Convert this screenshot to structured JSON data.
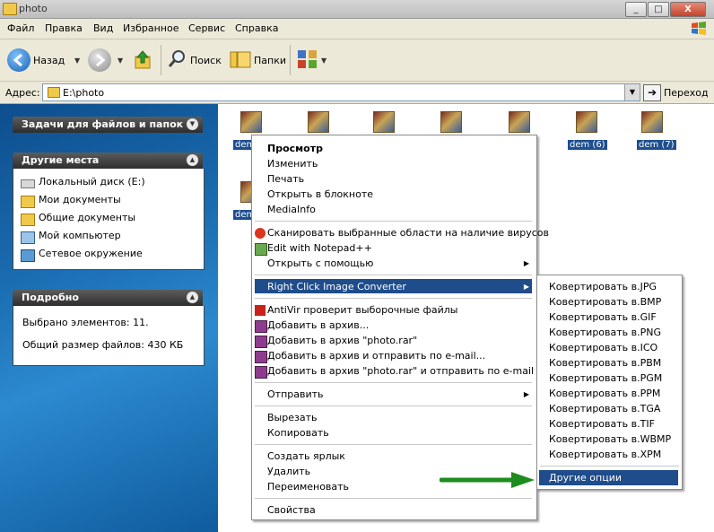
{
  "window": {
    "title": "photo",
    "buttons": {
      "minimize": "_",
      "maximize": "□",
      "close": "X"
    }
  },
  "menubar": {
    "items": [
      "Файл",
      "Правка",
      "Вид",
      "Избранное",
      "Сервис",
      "Справка"
    ]
  },
  "toolbar": {
    "back_label": "Назад",
    "search_label": "Поиск",
    "folders_label": "Папки"
  },
  "address": {
    "label": "Адрес:",
    "value": "E:\\photo",
    "go_label": "Переход"
  },
  "left_panel": {
    "tasks_title": "Задачи для файлов и папок",
    "places_title": "Другие места",
    "places": [
      "Локальный диск (E:)",
      "Мои документы",
      "Общие документы",
      "Мой компьютер",
      "Сетевое окружение"
    ],
    "details_title": "Подробно",
    "details_selected": "Выбрано элементов: 11.",
    "details_size": "Общий размер файлов: 430 КБ"
  },
  "files": {
    "visible_labels": [
      "dem",
      "dem (6)",
      "dem (7)",
      "dem"
    ]
  },
  "context_menu": {
    "items": [
      "Просмотр",
      "Изменить",
      "Печать",
      "Открыть в блокноте",
      "MediaInfo",
      "Сканировать выбранные области на наличие вирусов",
      "Edit with Notepad++",
      "Открыть с помощью",
      "Right Click Image Converter",
      "AntiVir проверит выборочные файлы",
      "Добавить в архив...",
      "Добавить в архив \"photo.rar\"",
      "Добавить в архив и отправить по e-mail...",
      "Добавить в архив \"photo.rar\" и отправить по e-mail",
      "Отправить",
      "Вырезать",
      "Копировать",
      "Создать ярлык",
      "Удалить",
      "Переименовать",
      "Свойства"
    ]
  },
  "submenu": {
    "items": [
      "Ковертировать в.JPG",
      "Ковертировать в.BMP",
      "Ковертировать в.GIF",
      "Ковертировать в.PNG",
      "Ковертировать в.ICO",
      "Ковертировать в.PBM",
      "Ковертировать в.PGM",
      "Ковертировать в.PPM",
      "Ковертировать в.TGA",
      "Ковертировать в.TIF",
      "Ковертировать в.WBMP",
      "Ковертировать в.XPM",
      "Другие опции"
    ]
  },
  "colors": {
    "highlight": "#1f4c8b",
    "annotation_arrow": "#1e8c1e",
    "panel_bg": "#1a6cb0"
  }
}
